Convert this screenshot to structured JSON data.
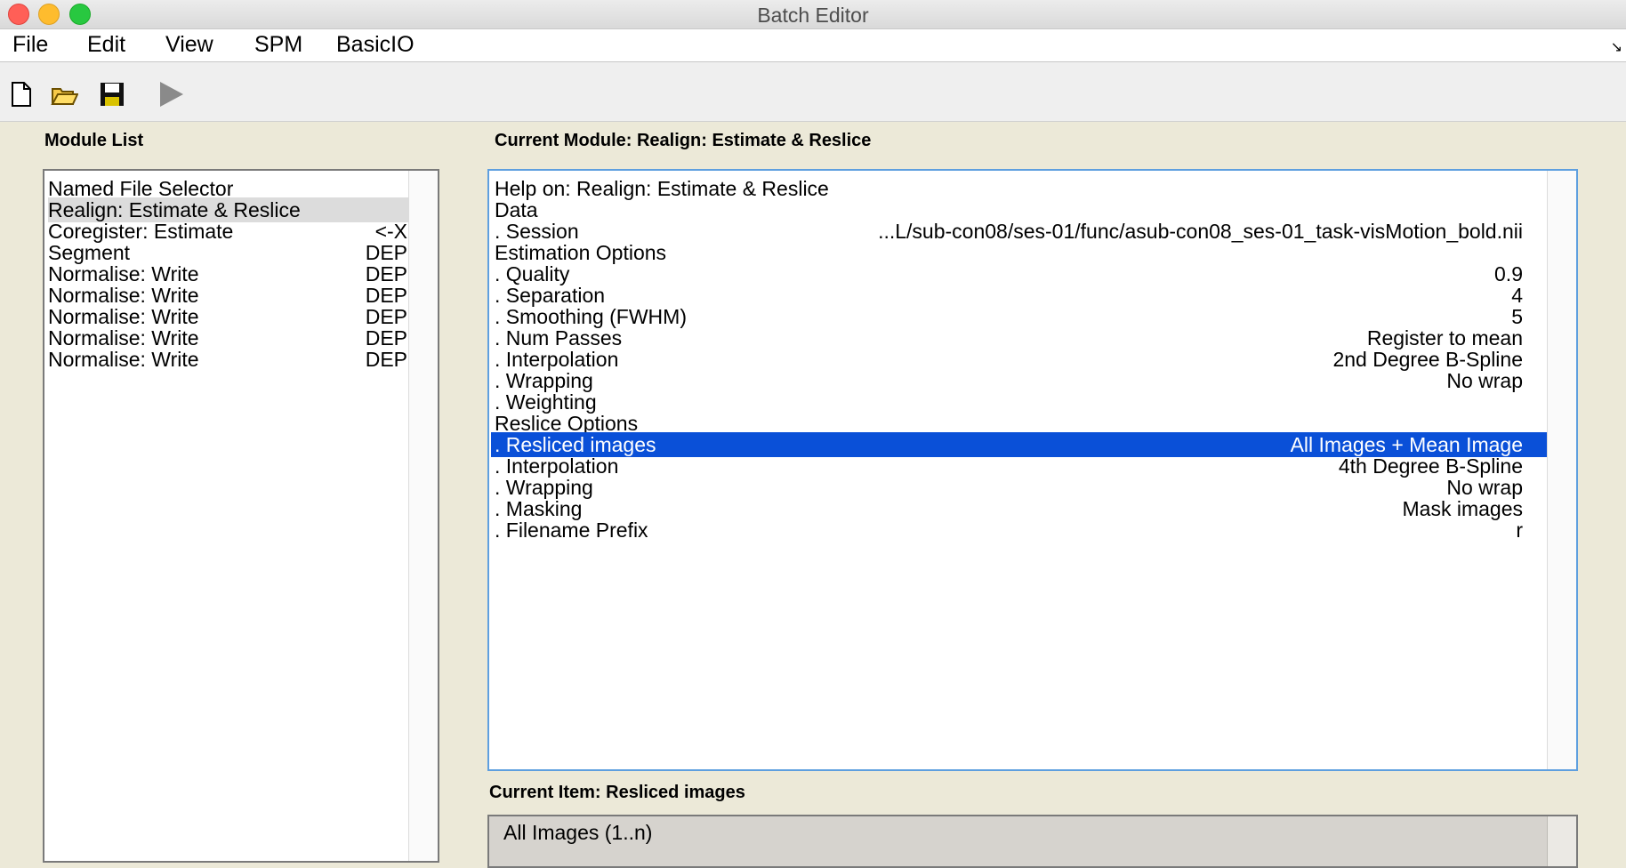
{
  "window": {
    "title": "Batch Editor"
  },
  "menu": [
    "File",
    "Edit",
    "View",
    "SPM",
    "BasicIO"
  ],
  "toolbar": {
    "icons": [
      "new-file-icon",
      "open-folder-icon",
      "save-icon",
      "run-icon"
    ]
  },
  "module_list": {
    "label": "Module List",
    "items": [
      {
        "name": "Named File Selector",
        "status": ""
      },
      {
        "name": "Realign: Estimate & Reslice",
        "status": ""
      },
      {
        "name": "Coregister: Estimate",
        "status": "<-X"
      },
      {
        "name": "Segment",
        "status": "DEP"
      },
      {
        "name": "Normalise: Write",
        "status": "DEP"
      },
      {
        "name": "Normalise: Write",
        "status": "DEP"
      },
      {
        "name": "Normalise: Write",
        "status": "DEP"
      },
      {
        "name": "Normalise: Write",
        "status": "DEP"
      },
      {
        "name": "Normalise: Write",
        "status": "DEP"
      }
    ],
    "selected_index": 1
  },
  "current_module": {
    "label": "Current Module: Realign: Estimate & Reslice",
    "rows": [
      {
        "label": "Help on: Realign: Estimate & Reslice",
        "value": ""
      },
      {
        "label": "Data",
        "value": ""
      },
      {
        "label": ". Session",
        "value": "...L/sub-con08/ses-01/func/asub-con08_ses-01_task-visMotion_bold.nii"
      },
      {
        "label": "Estimation Options",
        "value": ""
      },
      {
        "label": ". Quality",
        "value": "0.9"
      },
      {
        "label": ". Separation",
        "value": "4"
      },
      {
        "label": ". Smoothing (FWHM)",
        "value": "5"
      },
      {
        "label": ". Num Passes",
        "value": "Register to mean"
      },
      {
        "label": ". Interpolation",
        "value": "2nd Degree B-Spline"
      },
      {
        "label": ". Wrapping",
        "value": "No wrap"
      },
      {
        "label": ". Weighting",
        "value": ""
      },
      {
        "label": "Reslice Options",
        "value": ""
      },
      {
        "label": ". Resliced images",
        "value": "All Images + Mean Image"
      },
      {
        "label": ". Interpolation",
        "value": "4th Degree B-Spline"
      },
      {
        "label": ". Wrapping",
        "value": "No wrap"
      },
      {
        "label": ". Masking",
        "value": "Mask images"
      },
      {
        "label": ". Filename Prefix",
        "value": "r"
      }
    ],
    "selected_index": 12
  },
  "current_item": {
    "label": "Current Item: Resliced images",
    "options": [
      "All Images (1..n)"
    ]
  },
  "colors": {
    "selection": "#0a50d8",
    "panel_border_focus": "#5e9fdf",
    "window_bg": "#ece9d8"
  }
}
